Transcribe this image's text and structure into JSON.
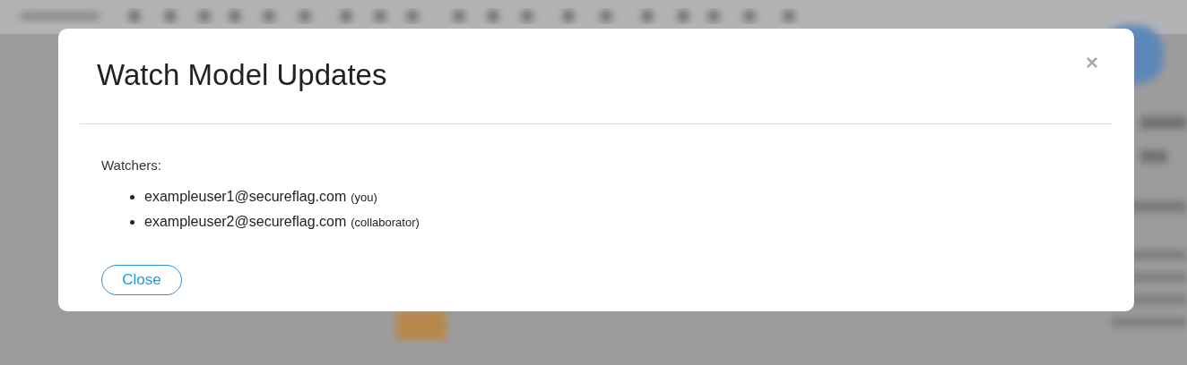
{
  "dialog": {
    "title": "Watch Model Updates",
    "close_icon": "×",
    "label": "Watchers:",
    "watchers": [
      {
        "email": "exampleuser1@secureflag.com",
        "role": "(you)"
      },
      {
        "email": "exampleuser2@secureflag.com",
        "role": "(collaborator)"
      }
    ],
    "buttons": [
      "Close"
    ]
  }
}
